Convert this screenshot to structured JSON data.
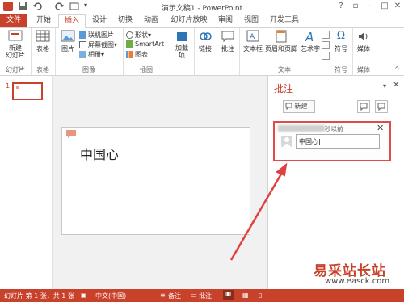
{
  "titlebar": {
    "title": "演示文稿1 - PowerPoint",
    "help": "?"
  },
  "tabs": [
    "文件",
    "开始",
    "插入",
    "设计",
    "切换",
    "动画",
    "幻灯片放映",
    "审阅",
    "视图",
    "开发工具"
  ],
  "ribbon": {
    "groups": [
      "幻灯片",
      "表格",
      "图像",
      "插图",
      "文本",
      "符号",
      "媒体"
    ],
    "new_slide": "新建\n幻灯片",
    "table": "表格",
    "picture": "图片",
    "online_picture": "联机图片",
    "screenshot": "屏幕截图",
    "album": "相册",
    "shapes": "形状",
    "smartart": "SmartArt",
    "chart": "图表",
    "addin": "加载\n项",
    "link": "链接",
    "comment": "批注",
    "textbox": "文本框",
    "header_footer": "页眉和页脚",
    "wordart": "艺术字",
    "symbol": "符号",
    "media": "媒体"
  },
  "thumbnails": {
    "slide_number": "1"
  },
  "slide": {
    "text": "中国心"
  },
  "comments": {
    "title": "批注",
    "new_button": "新建",
    "time": "秒以前",
    "input_value": "中国心"
  },
  "statusbar": {
    "slide_info": "幻灯片 第 1 张，共 1 张",
    "language": "中文(中国)",
    "notes": "备注",
    "comments": "批注"
  },
  "watermark": {
    "site": "易采站长站",
    "url": "www.easck.com"
  },
  "colors": {
    "accent": "#c8412b",
    "arrow": "#e04040"
  }
}
